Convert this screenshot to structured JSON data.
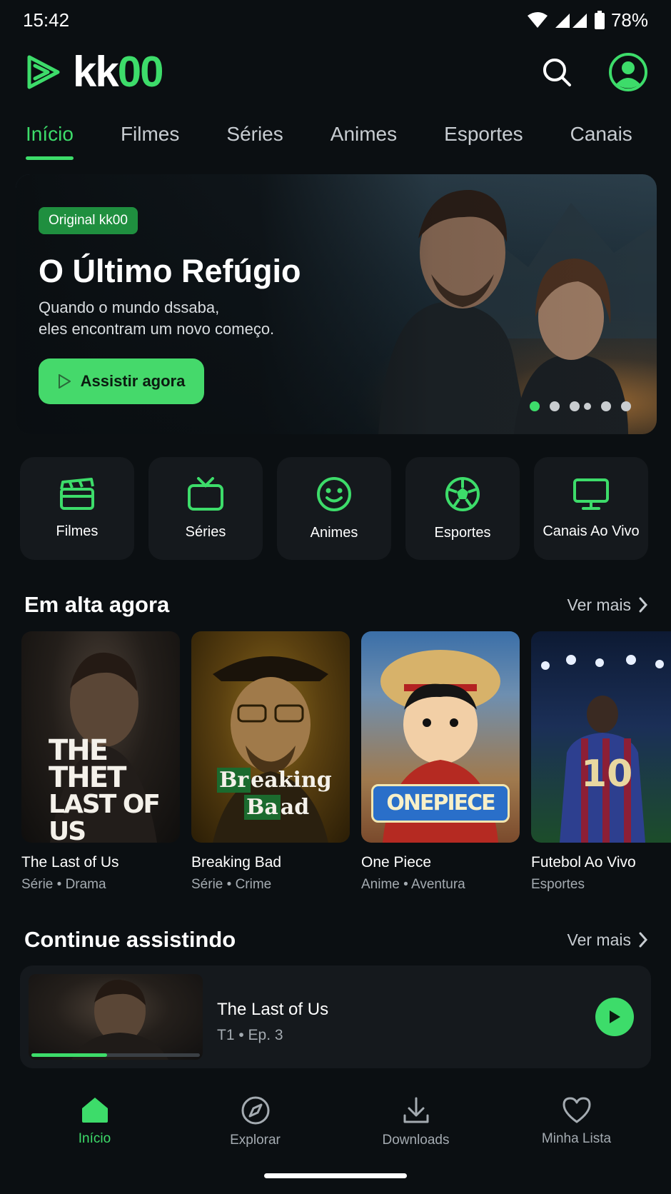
{
  "status_bar": {
    "time": "15:42",
    "battery": "78%"
  },
  "brand": {
    "name_white": "kk",
    "name_green": "00"
  },
  "header": {
    "search_icon": "search-icon",
    "profile_icon": "user-circle-icon"
  },
  "tabs": [
    {
      "label": "Início",
      "active": true
    },
    {
      "label": "Filmes"
    },
    {
      "label": "Séries"
    },
    {
      "label": "Animes"
    },
    {
      "label": "Esportes"
    },
    {
      "label": "Canais"
    }
  ],
  "hero": {
    "badge": "Original kk00",
    "title": "O Último Refúgio",
    "desc_line1": "Quando o mundo dssaba,",
    "desc_line2": "eles encontram um novo começo.",
    "cta": "Assistir agora",
    "slide_count": 6,
    "active_slide": 1
  },
  "categories": [
    {
      "label": "Filmes",
      "icon": "clapperboard-icon"
    },
    {
      "label": "Séries",
      "icon": "tv-icon"
    },
    {
      "label": "Animes",
      "icon": "smiley-icon"
    },
    {
      "label": "Esportes",
      "icon": "soccer-ball-icon"
    },
    {
      "label": "Canais Ao Vivo",
      "icon": "monitor-icon"
    }
  ],
  "trending": {
    "title": "Em alta agora",
    "see_more": "Ver mais",
    "items": [
      {
        "title": "The Last of Us",
        "meta": "Série • Drama",
        "poster_line1": "THE",
        "poster_line2": "THET",
        "poster_line3": "LAST OF US"
      },
      {
        "title": "Breaking Bad",
        "meta": "Série • Crime",
        "poster_line1": "Br",
        "poster_line1b": "eaking",
        "poster_line2": "Ba",
        "poster_line2b": "ad"
      },
      {
        "title": "One Piece",
        "meta": "Anime • Aventura",
        "poster_line1": "ONEPIECE"
      },
      {
        "title": "Futebol Ao Vivo",
        "meta": "Esportes",
        "poster_line1": "10"
      }
    ]
  },
  "continue": {
    "title": "Continue assistindo",
    "see_more": "Ver mais",
    "item": {
      "title": "The Last of Us",
      "meta": "T1 • Ep. 3",
      "progress": 0.45
    }
  },
  "bottom_nav": [
    {
      "label": "Início",
      "icon": "home-icon",
      "active": true
    },
    {
      "label": "Explorar",
      "icon": "compass-icon"
    },
    {
      "label": "Downloads",
      "icon": "download-icon"
    },
    {
      "label": "Minha Lista",
      "icon": "heart-icon"
    }
  ],
  "colors": {
    "accent": "#3ddc6a",
    "background": "#0b0f12",
    "card": "#15191d"
  }
}
